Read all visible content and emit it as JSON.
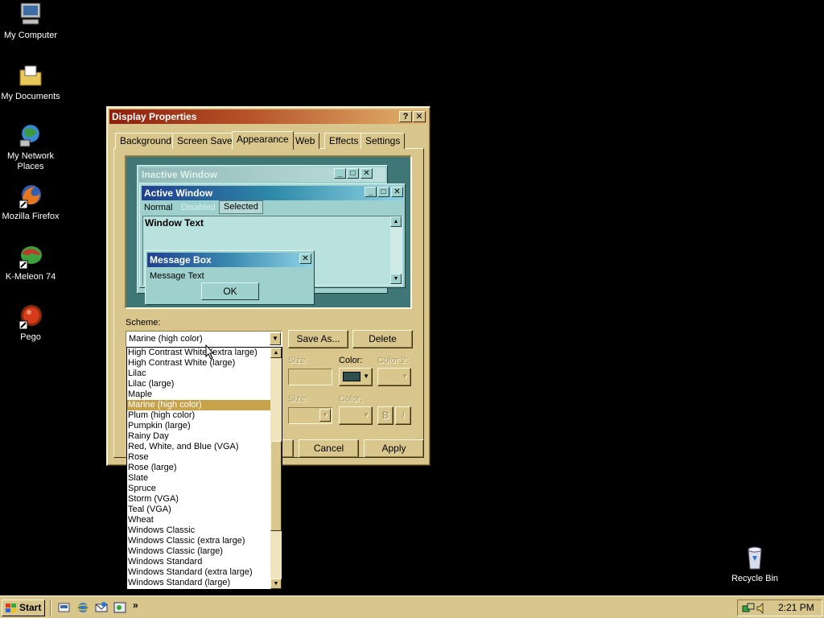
{
  "desktop": {
    "icons": [
      {
        "label": "My Computer",
        "icon": "my-computer-icon"
      },
      {
        "label": "My Documents",
        "icon": "my-documents-icon"
      },
      {
        "label_line1": "My Network",
        "label_line2": "Places",
        "icon": "network-places-icon"
      },
      {
        "label": "Mozilla Firefox",
        "icon": "firefox-icon"
      },
      {
        "label": "K-Meleon 74",
        "icon": "k-meleon-icon"
      },
      {
        "label": "Pego",
        "icon": "pego-icon"
      },
      {
        "label": "Recycle Bin",
        "icon": "recycle-bin-icon"
      }
    ]
  },
  "window": {
    "title": "Display Properties",
    "help_glyph": "?",
    "close_glyph": "✕",
    "tabs": [
      "Background",
      "Screen Saver",
      "Appearance",
      "Web",
      "Effects",
      "Settings"
    ],
    "active_tab": "Appearance"
  },
  "preview": {
    "inactive_title": "Inactive Window",
    "active_title": "Active Window",
    "menu": {
      "normal": "Normal",
      "disabled": "Disabled",
      "selected": "Selected"
    },
    "window_text": "Window Text",
    "msgbox_title": "Message Box",
    "msgbox_text": "Message Text",
    "ok": "OK"
  },
  "appearance": {
    "scheme_label": "Scheme:",
    "scheme_value": "Marine (high color)",
    "save_as": "Save As...",
    "delete": "Delete",
    "size_label": "Size:",
    "color_label": "Color:",
    "color2_label": "Color 2:",
    "size2_label": "Size:",
    "color3_label": "Color:",
    "bold_glyph": "B",
    "italic_glyph": "I",
    "item_color": "#2f4f4f"
  },
  "buttons": {
    "cancel": "Cancel",
    "apply": "Apply"
  },
  "scheme_list": [
    "High Contrast White (extra large)",
    "High Contrast White (large)",
    "Lilac",
    "Lilac (large)",
    "Maple",
    "Marine (high color)",
    "Plum (high color)",
    "Pumpkin (large)",
    "Rainy Day",
    "Red, White, and Blue (VGA)",
    "Rose",
    "Rose (large)",
    "Slate",
    "Spruce",
    "Storm (VGA)",
    "Teal (VGA)",
    "Wheat",
    "Windows Classic",
    "Windows Classic (extra large)",
    "Windows Classic (large)",
    "Windows Standard",
    "Windows Standard (extra large)",
    "Windows Standard (large)"
  ],
  "selected_scheme_index": 5,
  "taskbar": {
    "start": "Start",
    "chevron": "»",
    "clock": "2:21 PM"
  },
  "colors": {
    "window_face": "#d8c68c",
    "title_start": "#8e1f0c",
    "title_end": "#e3b46e",
    "preview_bg": "#3f7777",
    "active_title_start": "#1f3f8f",
    "selection": "#c8a24a"
  }
}
